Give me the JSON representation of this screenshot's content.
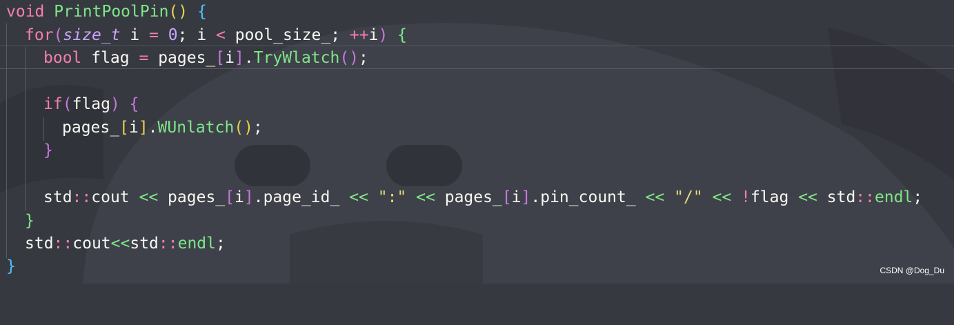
{
  "editor": {
    "background": "#373941",
    "lines": [
      "void PrintPoolPin() {",
      "  for(size_t i = 0; i < pool_size_; ++i) {",
      "    bool flag = pages_[i].TryWlatch();",
      "",
      "    if(flag) {",
      "      pages_[i].WUnlatch();",
      "    }",
      "",
      "    std::cout << pages_[i].page_id_ << \":\" << pages_[i].pin_count_ << \"/\" << !flag << std::endl;",
      "  }",
      "  std::cout<<std::endl;",
      "}"
    ],
    "highlighted_line": 3
  },
  "watermark": "CSDN @Dog_Du"
}
